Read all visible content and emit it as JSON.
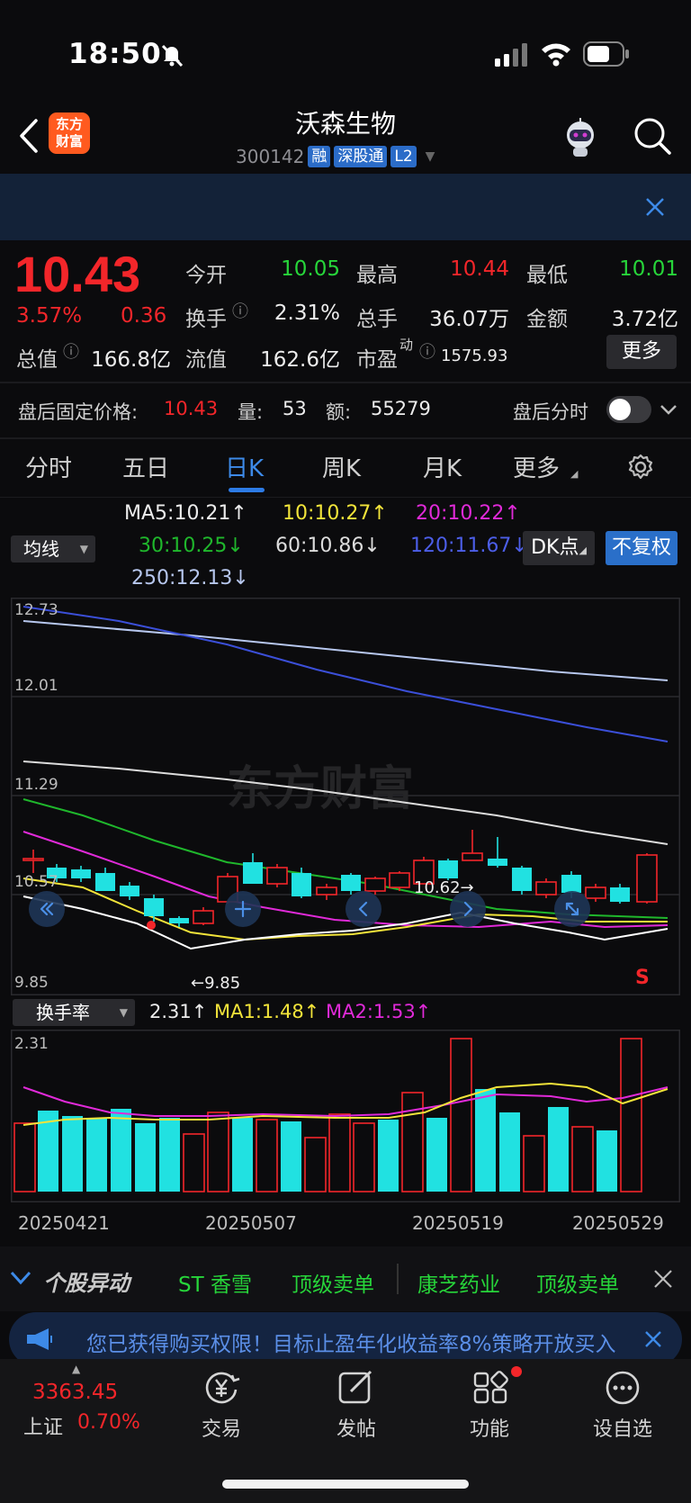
{
  "status_bar": {
    "time": "18:50"
  },
  "header": {
    "logo_line1": "东方",
    "logo_line2": "财富",
    "stock_name": "沃森生物",
    "stock_code": "300142",
    "tags": [
      "融",
      "深股通",
      "L2"
    ]
  },
  "quote": {
    "price": "10.43",
    "change_pct": "3.57%",
    "change": "0.36",
    "open_label": "今开",
    "open": "10.05",
    "high_label": "最高",
    "high": "10.44",
    "low_label": "最低",
    "low": "10.01",
    "turnover_label": "换手",
    "turnover": "2.31%",
    "volume_label": "总手",
    "volume": "36.07万",
    "amount_label": "金额",
    "amount": "3.72亿",
    "mktcap_label": "总值",
    "mktcap": "166.8亿",
    "float_label": "流值",
    "float": "162.6亿",
    "pe_label": "市盈",
    "pe_sup": "动",
    "pe": "1575.93",
    "more": "更多"
  },
  "after_hours": {
    "label": "盘后固定价格:",
    "price": "10.43",
    "vol_label": "量:",
    "vol": "53",
    "amt_label": "额:",
    "amt": "55279",
    "timeshare": "盘后分时"
  },
  "tabs": [
    "分时",
    "五日",
    "日K",
    "周K",
    "月K",
    "更多"
  ],
  "ma_legend": {
    "select": "均线",
    "ma5": "MA5:10.21↑",
    "ma10": "10:10.27↑",
    "ma20": "20:10.22↑",
    "ma30": "30:10.25↓",
    "ma60": "60:10.86↓",
    "ma120": "120:11.67↓",
    "ma250": "250:12.13↓",
    "dk": "DK点",
    "adjust": "不复权"
  },
  "kline": {
    "y_labels": [
      "12.73",
      "12.01",
      "11.29",
      "10.57",
      "9.85"
    ],
    "high_annot": "10.62→",
    "low_annot": "←9.85",
    "sell_mark": "S",
    "watermark": "东方财富",
    "colors": {
      "up": "#f3262a",
      "down": "#21e1e1",
      "ma5": "#ffffff",
      "ma10": "#f2e43a",
      "ma20": "#e02ad8",
      "ma30": "#1fb72c",
      "ma60": "#dcdcdc",
      "ma120": "#3b4fd8",
      "ma250": "#b7c7ee"
    }
  },
  "volume": {
    "select": "换手率",
    "value": "2.31↑",
    "ma1": "MA1:1.48↑",
    "ma2": "MA2:1.53↑",
    "y_top": "2.31",
    "dates": [
      "20250421",
      "20250507",
      "20250519",
      "20250529"
    ]
  },
  "news": {
    "title": "个股异动",
    "items": [
      "ST 香雪",
      "顶级卖单",
      "康芝药业",
      "顶级卖单"
    ]
  },
  "notify": {
    "text": "您已获得购买权限！目标止盈年化收益率8%策略开放买入"
  },
  "bottom_nav": {
    "index_value": "3363.45",
    "index_name": "上证",
    "index_pct": "0.70%",
    "items": [
      "交易",
      "发帖",
      "功能",
      "设自选"
    ]
  }
}
